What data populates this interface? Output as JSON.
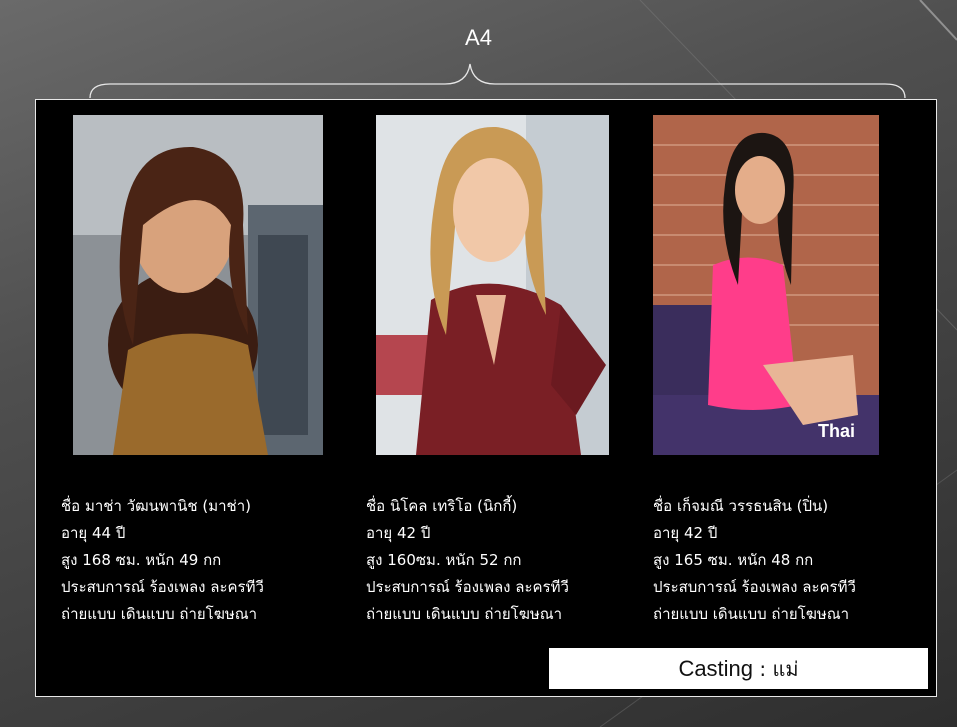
{
  "slide": {
    "format_label": "A4",
    "models": [
      {
        "name_line": "ชื่อ มาช่า  วัฒนพานิช (มาช่า)",
        "age_line": "อายุ 44 ปี",
        "size_line": "สูง 168 ซม.  หนัก 49 กก",
        "experience_line": "ประสบการณ์  ร้องเพลง  ละครทีวี",
        "experience_line2": "ถ่ายแบบ เดินแบบ ถ่ายโฆษณา"
      },
      {
        "name_line": "ชื่อ นิโคล เทริโอ (นิกกี้)",
        "age_line": "อายุ 42 ปี",
        "size_line": "สูง 160ซม.  หนัก 52 กก",
        "experience_line": "ประสบการณ์ ร้องเพลง  ละครทีวี",
        "experience_line2": "ถ่ายแบบ เดินแบบ ถ่ายโฆษณา"
      },
      {
        "name_line": "ชื่อ เก็จมณี วรรธนสิน (ปิ่น)",
        "age_line": "อายุ 42 ปี",
        "size_line": "สูง 165 ซม.  หนัก 48 กก",
        "experience_line": "ประสบการณ์  ร้องเพลง  ละครทีวี",
        "experience_line2": "ถ่ายแบบ เดินแบบ ถ่ายโฆษณา",
        "photo_watermark": "Thai"
      }
    ],
    "casting": {
      "label": "Casting",
      "separator": " : ",
      "role": "แม่"
    }
  },
  "colors": {
    "card_background": "#000000",
    "text": "#ffffff",
    "casting_box": "#ffffff",
    "dress_pink": "#ff3d8a",
    "suit_maroon": "#7a1f25",
    "top_mustard": "#9a6a2c"
  }
}
